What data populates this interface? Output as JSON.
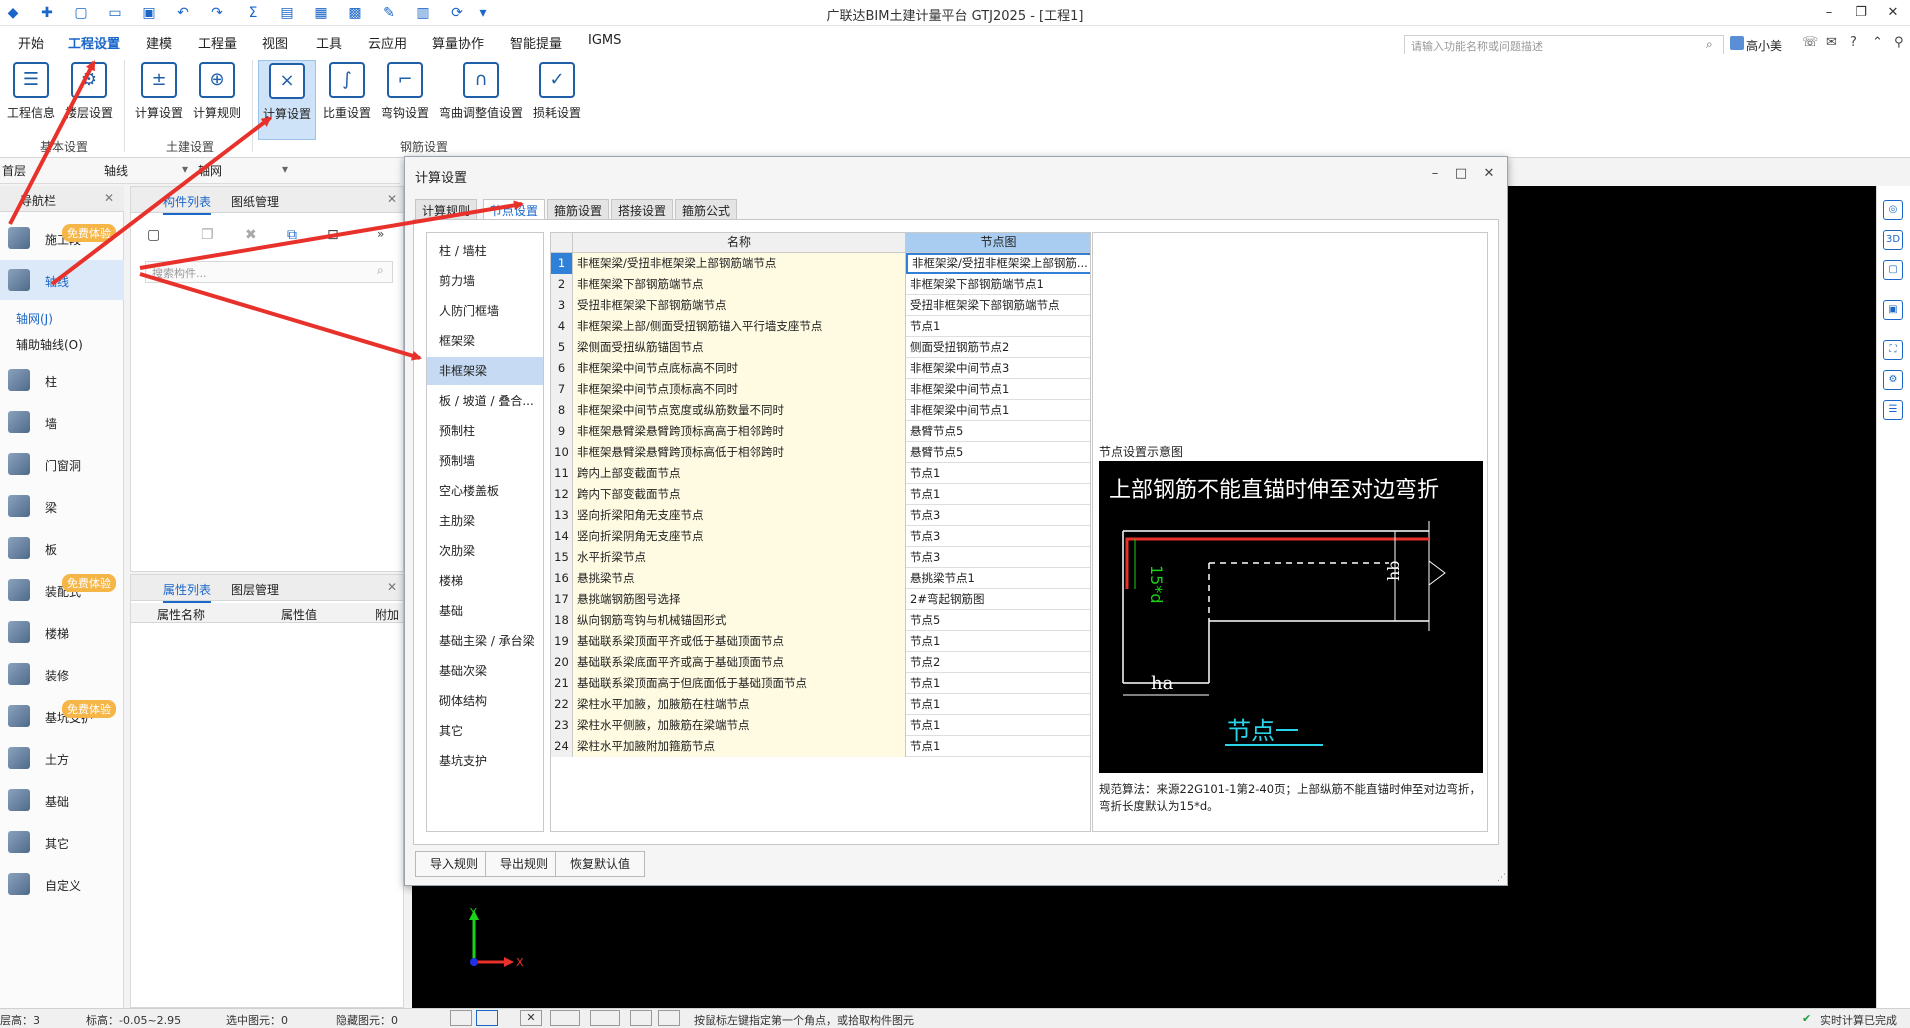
{
  "app": {
    "title": "广联达BIM土建计量平台 GTJ2025 - [工程1]",
    "search_placeholder": "请输入功能名称或问题描述",
    "user": "高小美"
  },
  "menu": [
    "开始",
    "工程设置",
    "建模",
    "工程量",
    "视图",
    "工具",
    "云应用",
    "算量协作",
    "智能提量",
    "IGMS"
  ],
  "ribbon": {
    "buttons": [
      "工程信息",
      "楼层设置",
      "计算设置",
      "计算规则",
      "计算设置",
      "比重设置",
      "弯钩设置",
      "弯曲调整值设置",
      "损耗设置"
    ],
    "groups": [
      "基本设置",
      "土建设置",
      "钢筋设置"
    ]
  },
  "floorbar": {
    "floor": "首层",
    "type": "轴线",
    "sub": "轴网"
  },
  "nav": {
    "title": "导航栏",
    "badge": "免费体验",
    "items": [
      "施工段",
      "轴线",
      "柱",
      "墙",
      "门窗洞",
      "梁",
      "板",
      "装配式",
      "楼梯",
      "装修",
      "基坑支护",
      "土方",
      "基础",
      "其它",
      "自定义"
    ],
    "sub": [
      "轴网(J)",
      "辅助轴线(O)"
    ]
  },
  "complist": {
    "tabs": [
      "构件列表",
      "图纸管理"
    ],
    "search_placeholder": "搜索构件..."
  },
  "attrlist": {
    "tabs": [
      "属性列表",
      "图层管理"
    ],
    "cols": [
      "属性名称",
      "属性值",
      "附加"
    ]
  },
  "dialog": {
    "title": "计算设置",
    "tabs": [
      "计算规则",
      "节点设置",
      "箍筋设置",
      "搭接设置",
      "箍筋公式"
    ],
    "categories": [
      "柱 / 墙柱",
      "剪力墙",
      "人防门框墙",
      "框架梁",
      "非框架梁",
      "板 / 坡道 / 叠合...",
      "预制柱",
      "预制墙",
      "空心楼盖板",
      "主肋梁",
      "次肋梁",
      "楼梯",
      "基础",
      "基础主梁 / 承台梁",
      "基础次梁",
      "砌体结构",
      "其它",
      "基坑支护"
    ],
    "columns": [
      "名称",
      "节点图"
    ],
    "rows": [
      [
        "1",
        "非框架梁/受扭非框架梁上部钢筋端节点",
        "非框架梁/受扭非框架梁上部钢筋..."
      ],
      [
        "2",
        "非框架梁下部钢筋端节点",
        "非框架梁下部钢筋端节点1"
      ],
      [
        "3",
        "受扭非框架梁下部钢筋端节点",
        "受扭非框架梁下部钢筋端节点"
      ],
      [
        "4",
        "非框架梁上部/侧面受扭钢筋锚入平行墙支座节点",
        "节点1"
      ],
      [
        "5",
        "梁侧面受扭纵筋锚固节点",
        "侧面受扭钢筋节点2"
      ],
      [
        "6",
        "非框架梁中间节点底标高不同时",
        "非框架梁中间节点3"
      ],
      [
        "7",
        "非框架梁中间节点顶标高不同时",
        "非框架梁中间节点1"
      ],
      [
        "8",
        "非框架梁中间节点宽度或纵筋数量不同时",
        "非框架梁中间节点1"
      ],
      [
        "9",
        "非框架悬臂梁悬臂跨顶标高高于相邻跨时",
        "悬臂节点5"
      ],
      [
        "10",
        "非框架悬臂梁悬臂跨顶标高低于相邻跨时",
        "悬臂节点5"
      ],
      [
        "11",
        "跨内上部变截面节点",
        "节点1"
      ],
      [
        "12",
        "跨内下部变截面节点",
        "节点1"
      ],
      [
        "13",
        "竖向折梁阳角无支座节点",
        "节点3"
      ],
      [
        "14",
        "竖向折梁阴角无支座节点",
        "节点3"
      ],
      [
        "15",
        "水平折梁节点",
        "节点3"
      ],
      [
        "16",
        "悬挑梁节点",
        "悬挑梁节点1"
      ],
      [
        "17",
        "悬挑端钢筋图号选择",
        "2#弯起钢筋图"
      ],
      [
        "18",
        "纵向钢筋弯钩与机械锚固形式",
        "节点5"
      ],
      [
        "19",
        "基础联系梁顶面平齐或低于基础顶面节点",
        "节点1"
      ],
      [
        "20",
        "基础联系梁底面平齐或高于基础顶面节点",
        "节点2"
      ],
      [
        "21",
        "基础联系梁顶面高于但底面低于基础顶面节点",
        "节点1"
      ],
      [
        "22",
        "梁柱水平加腋，加腋筋在柱端节点",
        "节点1"
      ],
      [
        "23",
        "梁柱水平侧腋，加腋筋在梁端节点",
        "节点1"
      ],
      [
        "24",
        "梁柱水平加腋附加箍筋节点",
        "节点1"
      ]
    ],
    "preview_label": "节点设置示意图",
    "preview_heading": "上部钢筋不能直锚时伸至对边弯折",
    "preview_dim1": "15*d",
    "preview_dim2": "hb",
    "preview_dim3": "ha",
    "preview_caption": "节点一",
    "rule_text": "规范算法：来源22G101-1第2-40页；上部纵筋不能直锚时伸至对边弯折，弯折长度默认为15*d。",
    "buttons": [
      "导入规则",
      "导出规则",
      "恢复默认值"
    ]
  },
  "status": {
    "floor_height": "层高：3",
    "elevation": "标高：-0.05~2.95",
    "selected": "选中图元：0",
    "hidden": "隐藏图元：0",
    "hint": "按鼠标左键指定第一个角点，或拾取构件图元",
    "calc": "实时计算已完成"
  },
  "colors": {
    "accent": "#1a66c9",
    "arrow": "#e8312b",
    "badge": "#f5b547"
  }
}
